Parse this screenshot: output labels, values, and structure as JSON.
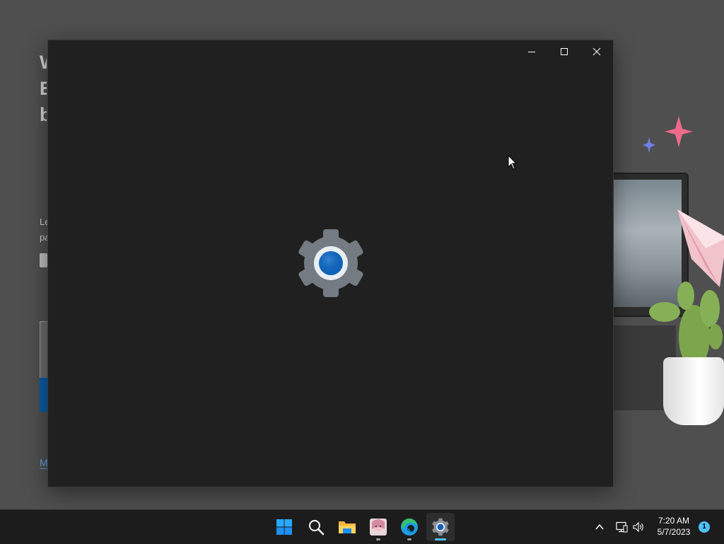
{
  "background_app": {
    "heading_lines": [
      "W",
      "E",
      "b"
    ],
    "sub_lines": [
      "Le",
      "pa"
    ],
    "link_text": "M"
  },
  "settings_window": {
    "title": "Settings",
    "controls": {
      "minimize_icon": "minimize-icon",
      "maximize_icon": "maximize-icon",
      "close_icon": "close-icon"
    },
    "splash_icon": "settings-gear-icon"
  },
  "taskbar": {
    "apps": [
      {
        "name": "Start",
        "icon": "windows-start-icon"
      },
      {
        "name": "Search",
        "icon": "search-icon"
      },
      {
        "name": "File Explorer",
        "icon": "folder-icon"
      },
      {
        "name": "Photos",
        "icon": "photo-app-icon"
      },
      {
        "name": "Microsoft Edge",
        "icon": "edge-browser-icon"
      },
      {
        "name": "Settings",
        "icon": "settings-gear-icon"
      }
    ],
    "tray": {
      "overflow_icon": "chevron-up-icon",
      "network_icon": "network-icon",
      "volume_icon": "volume-icon"
    },
    "clock": {
      "time": "7:20 AM",
      "date": "5/7/2023"
    },
    "notification_count": "1"
  },
  "colors": {
    "accent": "#4cc2ff",
    "window_bg": "#202020",
    "taskbar_bg": "#1c1c1c",
    "gear_blue": "#0f62b8"
  }
}
